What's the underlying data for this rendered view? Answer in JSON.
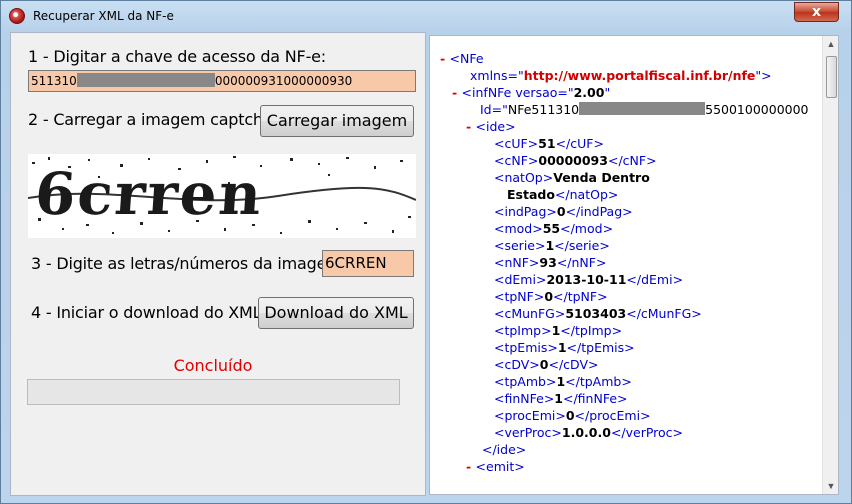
{
  "window": {
    "title": "Recuperar XML da NF-e",
    "close_glyph": "x"
  },
  "step1": {
    "label": "1 - Digitar a chave de acesso da NF-e:",
    "key_prefix": "511310",
    "key_suffix": "000000931000000930"
  },
  "step2": {
    "label": "2 - Carregar a imagem captcha:",
    "button": "Carregar imagem"
  },
  "captcha": {
    "text": "6crren"
  },
  "step3": {
    "label": "3 - Digite as letras/números da imagem:",
    "value": "6CRREN"
  },
  "step4": {
    "label": "4 - Iniciar o download do XML:",
    "button": "Download do XML"
  },
  "status": {
    "text": "Concluído"
  },
  "xml": {
    "lines": [
      {
        "pre": "- ",
        "open": "<NFe",
        "val": "",
        "close": ""
      },
      {
        "pre": "",
        "attr": "xmlns=\"",
        "url": "http://www.portalfiscal.inf.br/nfe",
        "end": "\">"
      },
      {
        "pre": "- ",
        "open": "<infNFe versao=\"",
        "val": "2.00",
        "close": "\""
      },
      {
        "pre": "",
        "attr": "Id=\"",
        "aval1": "NFe511310",
        "aval2": "5500100000000"
      },
      {
        "pre": "- ",
        "open": "<ide>",
        "val": "",
        "close": ""
      },
      {
        "open": "<cUF>",
        "val": "51",
        "close": "</cUF>"
      },
      {
        "open": "<cNF>",
        "val": "00000093",
        "close": "</cNF>"
      },
      {
        "open": "<natOp>",
        "val": "Venda Dentro",
        "close": ""
      },
      {
        "open": "",
        "val": "Estado",
        "close": "</natOp>"
      },
      {
        "open": "<indPag>",
        "val": "0",
        "close": "</indPag>"
      },
      {
        "open": "<mod>",
        "val": "55",
        "close": "</mod>"
      },
      {
        "open": "<serie>",
        "val": "1",
        "close": "</serie>"
      },
      {
        "open": "<nNF>",
        "val": "93",
        "close": "</nNF>"
      },
      {
        "open": "<dEmi>",
        "val": "2013-10-11",
        "close": "</dEmi>"
      },
      {
        "open": "<tpNF>",
        "val": "0",
        "close": "</tpNF>"
      },
      {
        "open": "<cMunFG>",
        "val": "5103403",
        "close": "</cMunFG>"
      },
      {
        "open": "<tpImp>",
        "val": "1",
        "close": "</tpImp>"
      },
      {
        "open": "<tpEmis>",
        "val": "1",
        "close": "</tpEmis>"
      },
      {
        "open": "<cDV>",
        "val": "0",
        "close": "</cDV>"
      },
      {
        "open": "<tpAmb>",
        "val": "1",
        "close": "</tpAmb>"
      },
      {
        "open": "<finNFe>",
        "val": "1",
        "close": "</finNFe>"
      },
      {
        "open": "<procEmi>",
        "val": "0",
        "close": "</procEmi>"
      },
      {
        "open": "<verProc>",
        "val": "1.0.0.0",
        "close": "</verProc>"
      },
      {
        "open": "</ide>",
        "val": "",
        "close": ""
      },
      {
        "pre": "- ",
        "open": "<emit>",
        "val": "",
        "close": ""
      }
    ]
  }
}
